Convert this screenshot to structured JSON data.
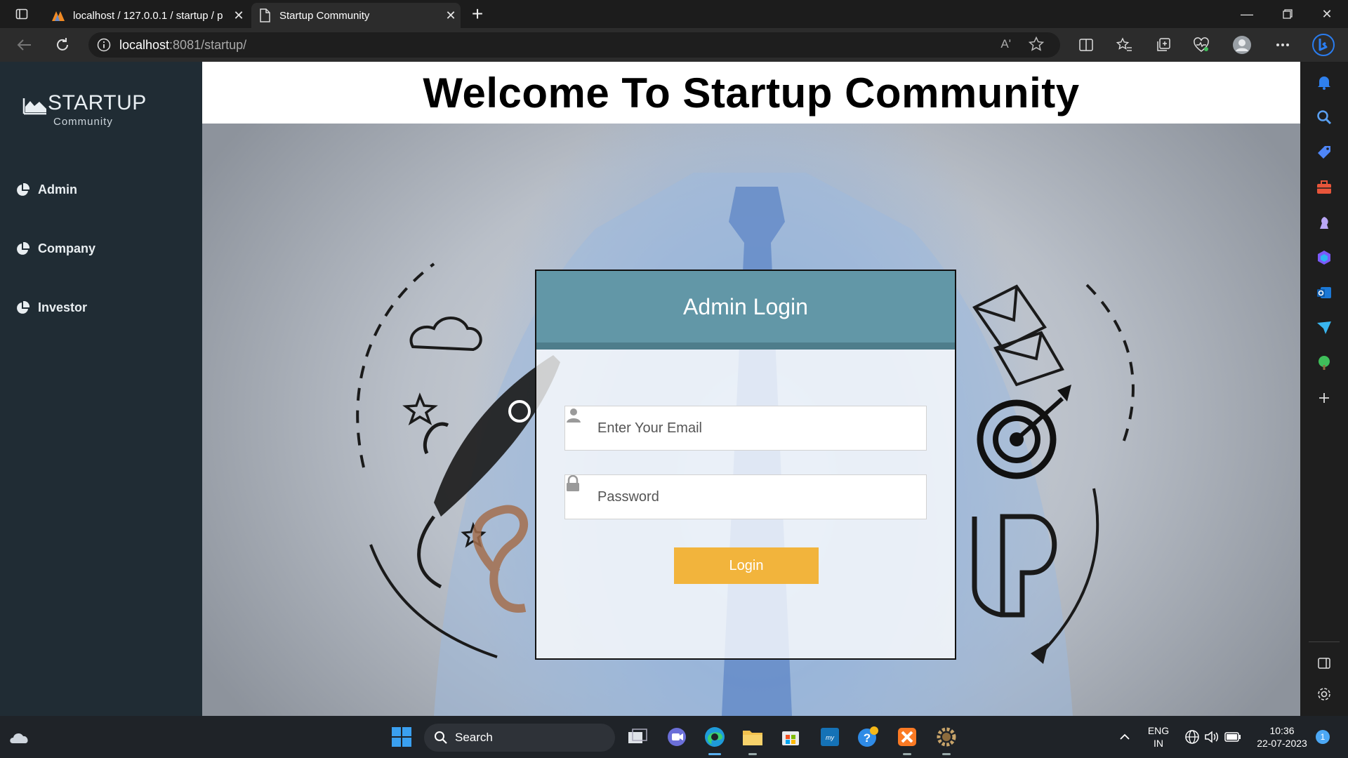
{
  "browser": {
    "tabs": [
      {
        "label": "localhost / 127.0.0.1 / startup / p",
        "active": false
      },
      {
        "label": "Startup Community",
        "active": true
      }
    ],
    "new_tab_label": "+",
    "address": {
      "host": "localhost",
      "rest": ":8081/startup/"
    },
    "read_aloud_label": "Aʹ"
  },
  "sidebar": {
    "logo_main": "STARTUP",
    "logo_sub": "Community",
    "items": [
      {
        "label": "Admin"
      },
      {
        "label": "Company"
      },
      {
        "label": "Investor"
      }
    ]
  },
  "page": {
    "title": "Welcome To Startup Community"
  },
  "login": {
    "heading": "Admin Login",
    "email_placeholder": "Enter Your Email",
    "password_placeholder": "Password",
    "button_label": "Login"
  },
  "taskbar": {
    "search_label": "Search",
    "lang_top": "ENG",
    "lang_bottom": "IN",
    "time": "10:36",
    "date": "22-07-2023",
    "notification_count": "1"
  },
  "colors": {
    "sidebar_bg": "#202c34",
    "card_header": "#6297a7",
    "login_button": "#f2b43c"
  }
}
